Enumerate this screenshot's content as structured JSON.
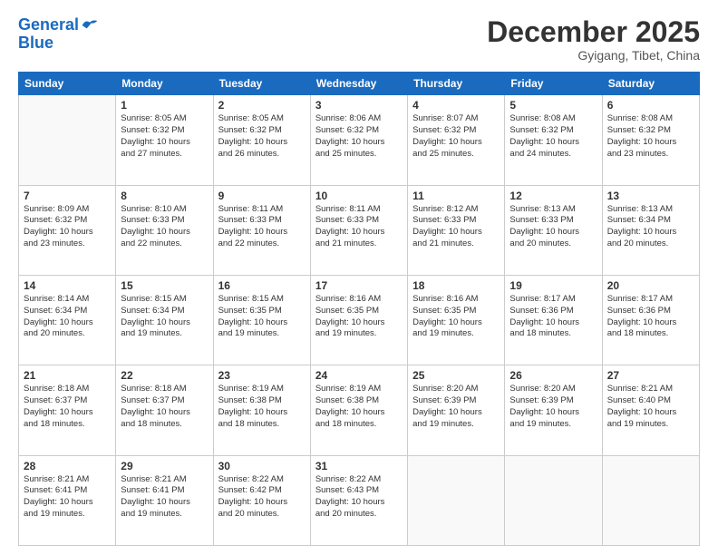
{
  "header": {
    "logo_line1": "General",
    "logo_line2": "Blue",
    "month": "December 2025",
    "location": "Gyigang, Tibet, China"
  },
  "days_header": [
    "Sunday",
    "Monday",
    "Tuesday",
    "Wednesday",
    "Thursday",
    "Friday",
    "Saturday"
  ],
  "weeks": [
    [
      {
        "num": "",
        "info": ""
      },
      {
        "num": "1",
        "info": "Sunrise: 8:05 AM\nSunset: 6:32 PM\nDaylight: 10 hours\nand 27 minutes."
      },
      {
        "num": "2",
        "info": "Sunrise: 8:05 AM\nSunset: 6:32 PM\nDaylight: 10 hours\nand 26 minutes."
      },
      {
        "num": "3",
        "info": "Sunrise: 8:06 AM\nSunset: 6:32 PM\nDaylight: 10 hours\nand 25 minutes."
      },
      {
        "num": "4",
        "info": "Sunrise: 8:07 AM\nSunset: 6:32 PM\nDaylight: 10 hours\nand 25 minutes."
      },
      {
        "num": "5",
        "info": "Sunrise: 8:08 AM\nSunset: 6:32 PM\nDaylight: 10 hours\nand 24 minutes."
      },
      {
        "num": "6",
        "info": "Sunrise: 8:08 AM\nSunset: 6:32 PM\nDaylight: 10 hours\nand 23 minutes."
      }
    ],
    [
      {
        "num": "7",
        "info": "Sunrise: 8:09 AM\nSunset: 6:32 PM\nDaylight: 10 hours\nand 23 minutes."
      },
      {
        "num": "8",
        "info": "Sunrise: 8:10 AM\nSunset: 6:33 PM\nDaylight: 10 hours\nand 22 minutes."
      },
      {
        "num": "9",
        "info": "Sunrise: 8:11 AM\nSunset: 6:33 PM\nDaylight: 10 hours\nand 22 minutes."
      },
      {
        "num": "10",
        "info": "Sunrise: 8:11 AM\nSunset: 6:33 PM\nDaylight: 10 hours\nand 21 minutes."
      },
      {
        "num": "11",
        "info": "Sunrise: 8:12 AM\nSunset: 6:33 PM\nDaylight: 10 hours\nand 21 minutes."
      },
      {
        "num": "12",
        "info": "Sunrise: 8:13 AM\nSunset: 6:33 PM\nDaylight: 10 hours\nand 20 minutes."
      },
      {
        "num": "13",
        "info": "Sunrise: 8:13 AM\nSunset: 6:34 PM\nDaylight: 10 hours\nand 20 minutes."
      }
    ],
    [
      {
        "num": "14",
        "info": "Sunrise: 8:14 AM\nSunset: 6:34 PM\nDaylight: 10 hours\nand 20 minutes."
      },
      {
        "num": "15",
        "info": "Sunrise: 8:15 AM\nSunset: 6:34 PM\nDaylight: 10 hours\nand 19 minutes."
      },
      {
        "num": "16",
        "info": "Sunrise: 8:15 AM\nSunset: 6:35 PM\nDaylight: 10 hours\nand 19 minutes."
      },
      {
        "num": "17",
        "info": "Sunrise: 8:16 AM\nSunset: 6:35 PM\nDaylight: 10 hours\nand 19 minutes."
      },
      {
        "num": "18",
        "info": "Sunrise: 8:16 AM\nSunset: 6:35 PM\nDaylight: 10 hours\nand 19 minutes."
      },
      {
        "num": "19",
        "info": "Sunrise: 8:17 AM\nSunset: 6:36 PM\nDaylight: 10 hours\nand 18 minutes."
      },
      {
        "num": "20",
        "info": "Sunrise: 8:17 AM\nSunset: 6:36 PM\nDaylight: 10 hours\nand 18 minutes."
      }
    ],
    [
      {
        "num": "21",
        "info": "Sunrise: 8:18 AM\nSunset: 6:37 PM\nDaylight: 10 hours\nand 18 minutes."
      },
      {
        "num": "22",
        "info": "Sunrise: 8:18 AM\nSunset: 6:37 PM\nDaylight: 10 hours\nand 18 minutes."
      },
      {
        "num": "23",
        "info": "Sunrise: 8:19 AM\nSunset: 6:38 PM\nDaylight: 10 hours\nand 18 minutes."
      },
      {
        "num": "24",
        "info": "Sunrise: 8:19 AM\nSunset: 6:38 PM\nDaylight: 10 hours\nand 18 minutes."
      },
      {
        "num": "25",
        "info": "Sunrise: 8:20 AM\nSunset: 6:39 PM\nDaylight: 10 hours\nand 19 minutes."
      },
      {
        "num": "26",
        "info": "Sunrise: 8:20 AM\nSunset: 6:39 PM\nDaylight: 10 hours\nand 19 minutes."
      },
      {
        "num": "27",
        "info": "Sunrise: 8:21 AM\nSunset: 6:40 PM\nDaylight: 10 hours\nand 19 minutes."
      }
    ],
    [
      {
        "num": "28",
        "info": "Sunrise: 8:21 AM\nSunset: 6:41 PM\nDaylight: 10 hours\nand 19 minutes."
      },
      {
        "num": "29",
        "info": "Sunrise: 8:21 AM\nSunset: 6:41 PM\nDaylight: 10 hours\nand 19 minutes."
      },
      {
        "num": "30",
        "info": "Sunrise: 8:22 AM\nSunset: 6:42 PM\nDaylight: 10 hours\nand 20 minutes."
      },
      {
        "num": "31",
        "info": "Sunrise: 8:22 AM\nSunset: 6:43 PM\nDaylight: 10 hours\nand 20 minutes."
      },
      {
        "num": "",
        "info": ""
      },
      {
        "num": "",
        "info": ""
      },
      {
        "num": "",
        "info": ""
      }
    ]
  ]
}
